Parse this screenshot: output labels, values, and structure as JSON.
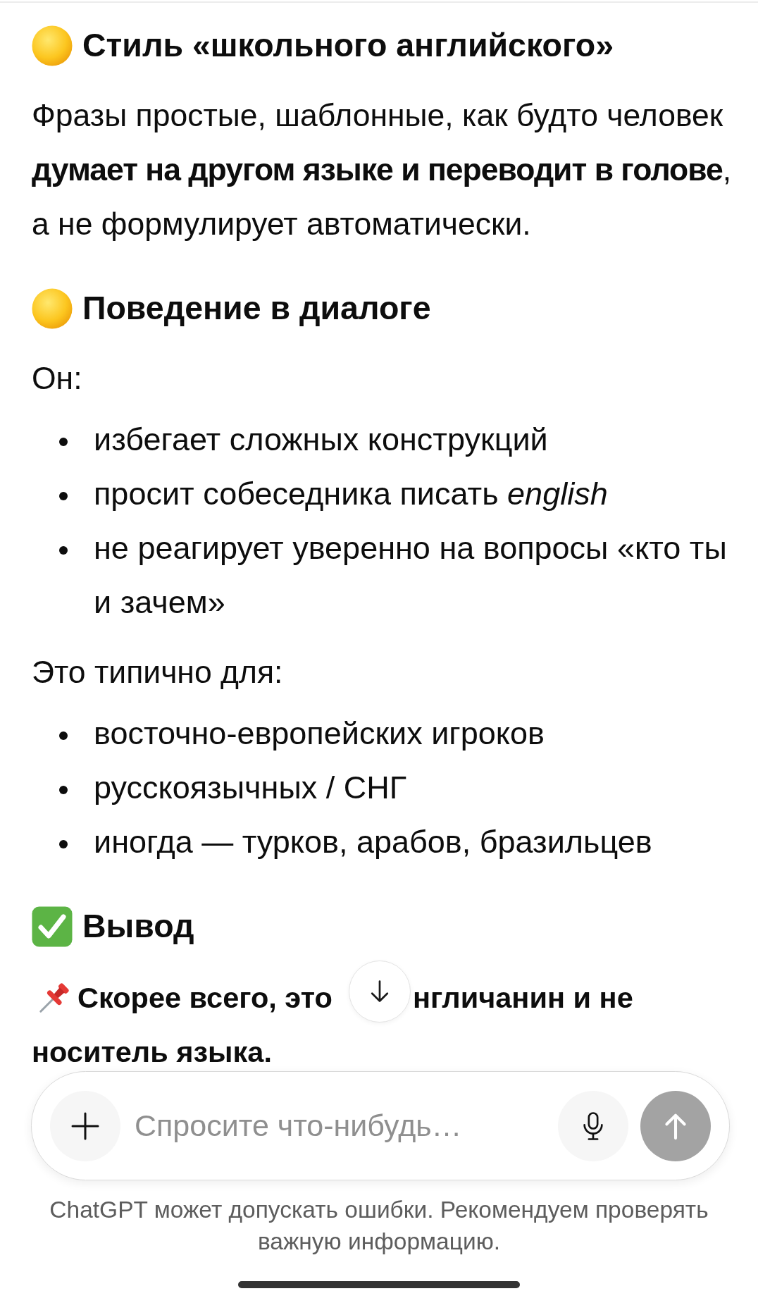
{
  "blocks": [
    {
      "kind": "heading",
      "text": "Стиль «школьного английского»"
    },
    {
      "kind": "paragraph",
      "text": "Фразы простые, шаблонные, как будто человек **думает на другом языке и переводит в голове**, а не формулирует автоматически."
    },
    {
      "kind": "heading",
      "text": "Поведение в диалоге"
    },
    {
      "kind": "paragraph",
      "text": "Он:"
    },
    {
      "kind": "list",
      "items": [
        "избегает сложных конструкций",
        "просит собеседника писать *english*",
        "не реагирует уверенно на вопросы «кто ты и зачем»"
      ]
    },
    {
      "kind": "paragraph",
      "text": "Это типично для:"
    },
    {
      "kind": "list",
      "items": [
        "восточно-европейских игроков",
        "русскоязычных / СНГ",
        "иногда — турков, арабов, бразильцев"
      ]
    },
    {
      "kind": "verdict",
      "text": "Вывод"
    },
    {
      "kind": "note",
      "text_before_button": "Скорее всего, это",
      "text_after_button": "нгличанин и не",
      "text_next_line": "носитель языка."
    }
  ],
  "composer": {
    "placeholder": "Спросите что-нибудь…"
  },
  "disclaimer": "ChatGPT может допускать ошибки. Рекомендуем проверять важную информацию."
}
